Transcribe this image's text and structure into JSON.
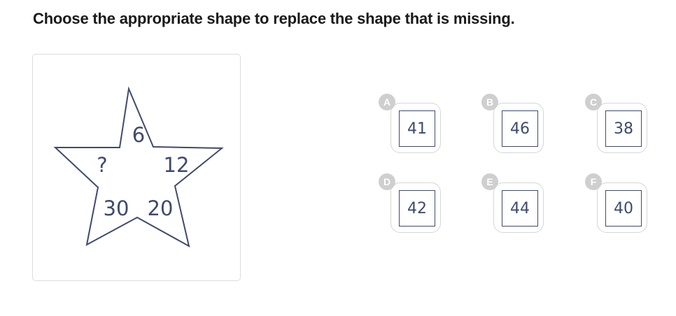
{
  "question": "Choose the appropriate shape to replace the shape that is missing.",
  "star": {
    "top": "6",
    "right": "12",
    "bottom_right": "20",
    "bottom_left": "30",
    "left": "?"
  },
  "options": [
    {
      "letter": "A",
      "value": "41"
    },
    {
      "letter": "B",
      "value": "46"
    },
    {
      "letter": "C",
      "value": "38"
    },
    {
      "letter": "D",
      "value": "42"
    },
    {
      "letter": "E",
      "value": "44"
    },
    {
      "letter": "F",
      "value": "40"
    }
  ],
  "colors": {
    "ink": "#3f4a6e",
    "badge": "#cfcfcf",
    "border": "#d6d6d6"
  }
}
